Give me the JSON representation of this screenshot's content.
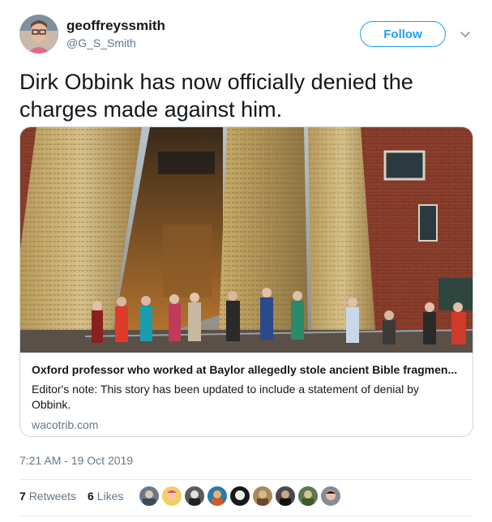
{
  "author": {
    "display_name": "geoffreyssmith",
    "handle": "@G_S_Smith"
  },
  "follow_label": "Follow",
  "tweet_text": "Dirk Obbink has now officially denied the charges made against him.",
  "card": {
    "title": "Oxford professor who worked at Baylor allegedly stole ancient Bible fragmen...",
    "description": "Editor's note: This story has been updated to include a statement of denial by Obbink.",
    "domain": "wacotrib.com"
  },
  "timestamp": "7:21 AM - 19 Oct 2019",
  "stats": {
    "retweets_count": "7",
    "retweets_label": "Retweets",
    "likes_count": "6",
    "likes_label": "Likes"
  },
  "colors": {
    "accent": "#1da1f2",
    "text": "#14171a",
    "secondary": "#657786",
    "border": "#ccd6dd"
  },
  "liker_avatars": [
    {
      "icon": "avatar-1"
    },
    {
      "icon": "avatar-2"
    },
    {
      "icon": "avatar-3"
    },
    {
      "icon": "avatar-4"
    },
    {
      "icon": "avatar-5"
    },
    {
      "icon": "avatar-6"
    },
    {
      "icon": "avatar-7"
    },
    {
      "icon": "avatar-8"
    },
    {
      "icon": "avatar-9"
    }
  ]
}
